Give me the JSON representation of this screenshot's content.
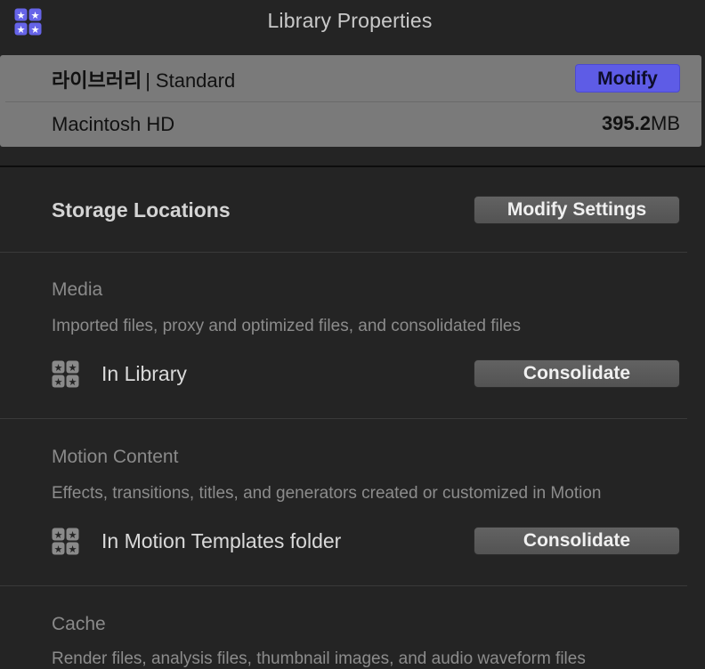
{
  "panel": {
    "title": "Library Properties"
  },
  "library": {
    "name": "라이브러리",
    "separator": "|",
    "type": "Standard",
    "modify_label": "Modify",
    "volume": "Macintosh HD",
    "size_value": "395.2",
    "size_unit": "MB"
  },
  "storage": {
    "title": "Storage Locations",
    "modify_settings_label": "Modify Settings"
  },
  "media": {
    "heading": "Media",
    "description": "Imported files, proxy and optimized files, and consolidated files",
    "location": "In Library",
    "button_label": "Consolidate"
  },
  "motion": {
    "heading": "Motion Content",
    "description": "Effects, transitions, titles, and generators created or customized in Motion",
    "location": "In Motion Templates folder",
    "button_label": "Consolidate"
  },
  "cache": {
    "heading": "Cache",
    "description": "Render files, analysis files, thumbnail images, and audio waveform files"
  },
  "colors": {
    "accent": "#5e5ce6",
    "background": "#242424",
    "header": "#7a7a7a"
  },
  "icons": {
    "app": "library-stars-icon",
    "location": "library-stars-icon"
  }
}
